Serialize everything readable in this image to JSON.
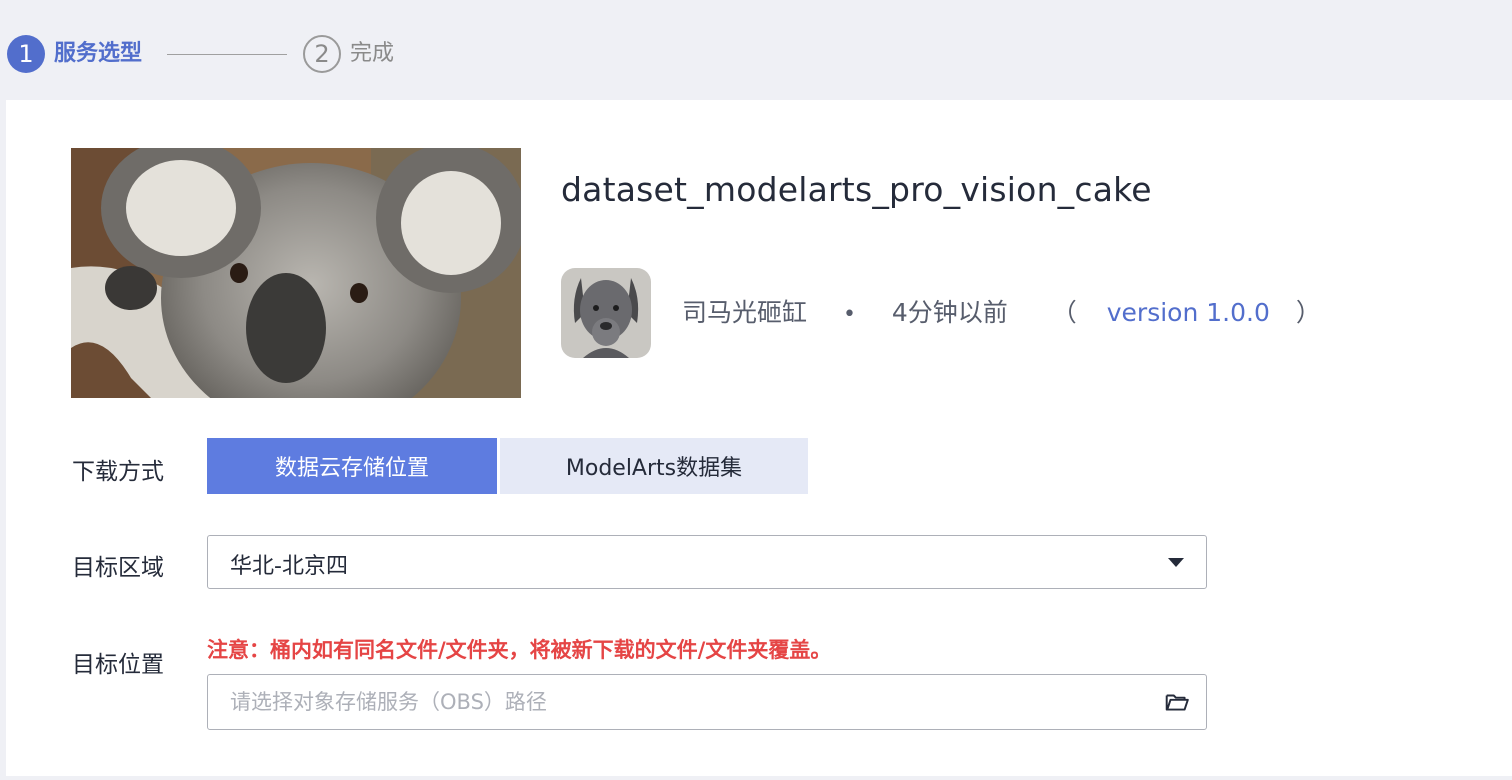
{
  "stepper": {
    "step1_number": "1",
    "step1_label": "服务选型",
    "step2_number": "2",
    "step2_label": "完成"
  },
  "dataset": {
    "title": "dataset_modelarts_pro_vision_cake",
    "author": "司马光砸缸",
    "separator": "•",
    "updated": "4分钟以前",
    "paren_open": "（",
    "version": "version 1.0.0",
    "paren_close": "）"
  },
  "download": {
    "label": "下载方式",
    "options": [
      "数据云存储位置",
      "ModelArts数据集"
    ],
    "selected": "数据云存储位置"
  },
  "region": {
    "label": "目标区域",
    "value": "华北-北京四"
  },
  "target": {
    "label": "目标位置",
    "warning": "注意：桶内如有同名文件/文件夹，将被新下载的文件/文件夹覆盖。",
    "placeholder": "请选择对象存储服务（OBS）路径"
  },
  "colors": {
    "accent": "#526ecc",
    "active_button": "#5e7ce0",
    "inactive_button": "#e5e9f6",
    "warning": "#e54545",
    "background": "#eff0f5"
  },
  "icons": {
    "folder": "folder-open-icon",
    "dropdown": "caret-down-icon"
  }
}
